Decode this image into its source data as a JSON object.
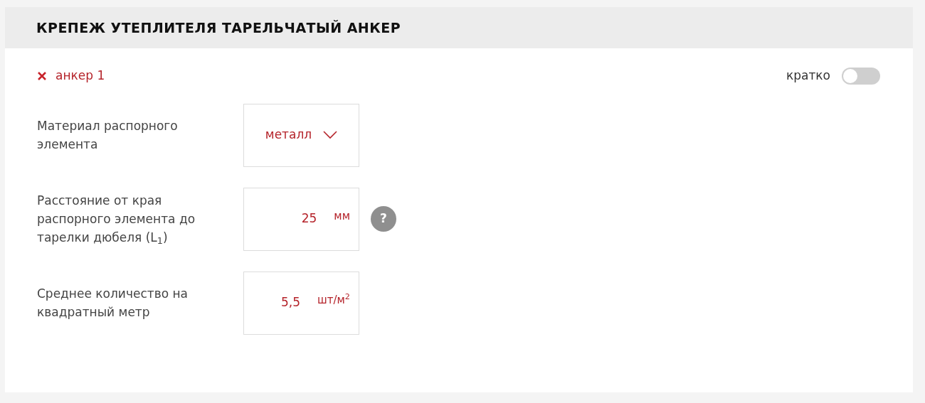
{
  "title": "КРЕПЕЖ УТЕПЛИТЕЛЯ ТАРЕЛЬЧАТЫЙ АНКЕР",
  "anchor": {
    "label": "анкер 1"
  },
  "brief": {
    "label": "кратко",
    "on": false
  },
  "fields": [
    {
      "kind": "select",
      "label": "Материал распорного элемента",
      "value": "металл"
    },
    {
      "kind": "number",
      "label": "Расстояние от края распорного элемента до тарелки дюбеля (L$_{1}$)",
      "value": "25",
      "unit": "мм",
      "help": "?"
    },
    {
      "kind": "number",
      "label": "Среднее количество на квадратный метр",
      "value": "5,5",
      "unit": "шт/м$^{2}$"
    }
  ]
}
